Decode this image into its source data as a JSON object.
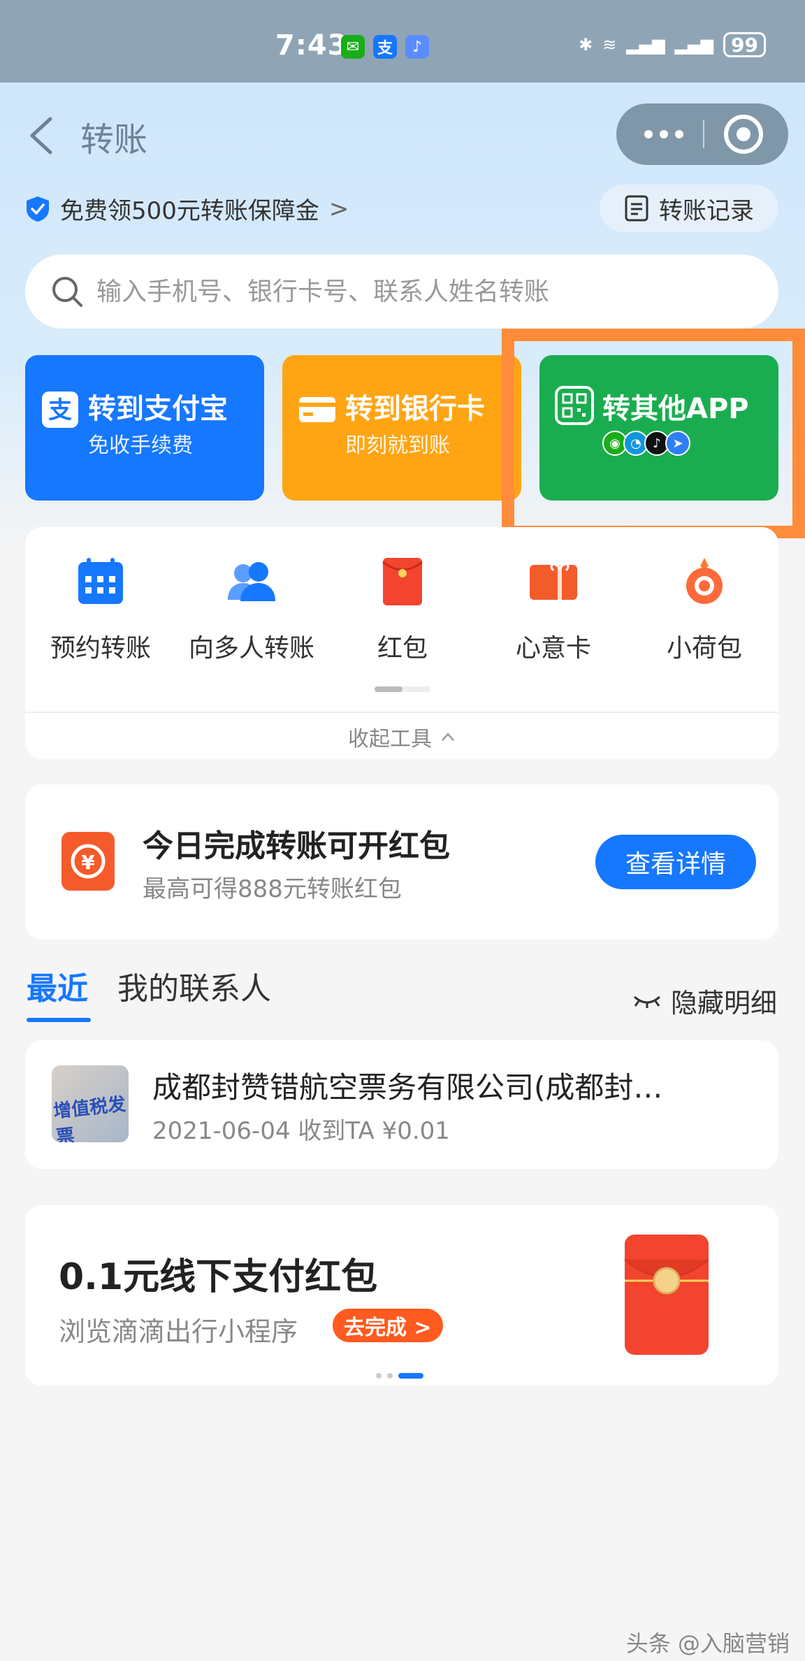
{
  "status_bar": {
    "time": "7:43",
    "battery": "99"
  },
  "nav": {
    "title": "转账"
  },
  "guarantee": {
    "text": "免费领500元转账保障金",
    "chevron": ">"
  },
  "records": {
    "label": "转账记录"
  },
  "search": {
    "placeholder": "输入手机号、银行卡号、联系人姓名转账"
  },
  "actions": [
    {
      "title": "转到支付宝",
      "subtitle": "免收手续费"
    },
    {
      "title": "转到银行卡",
      "subtitle": "即刻就到账"
    },
    {
      "title": "转其他APP",
      "subtitle": ""
    }
  ],
  "tools": [
    {
      "label": "预约转账",
      "icon": "calendar-icon"
    },
    {
      "label": "向多人转账",
      "icon": "people-icon"
    },
    {
      "label": "红包",
      "icon": "red-packet-icon"
    },
    {
      "label": "心意卡",
      "icon": "gift-card-icon"
    },
    {
      "label": "小荷包",
      "icon": "lotus-pouch-icon"
    }
  ],
  "collapse": {
    "label": "收起工具"
  },
  "promo1": {
    "title": "今日完成转账可开红包",
    "subtitle": "最高可得888元转账红包",
    "button": "查看详情"
  },
  "tabs": {
    "recent": "最近",
    "contacts": "我的联系人"
  },
  "hide_detail": {
    "label": "隐藏明细"
  },
  "contact": {
    "avatar_text": "增值税发票",
    "name": "成都封赞错航空票务有限公司(成都封…",
    "subtitle": "2021-06-04 收到TA ¥0.01"
  },
  "promo2": {
    "title": "0.1元线下支付红包",
    "subtitle": "浏览滴滴出行小程序",
    "button": "去完成 >"
  },
  "watermark": "头条 @入脑营销",
  "colors": {
    "primary": "#1677ff",
    "orange": "#ffa514",
    "green": "#1aad4f",
    "highlight": "#ff8c3a",
    "red": "#f2442e"
  }
}
